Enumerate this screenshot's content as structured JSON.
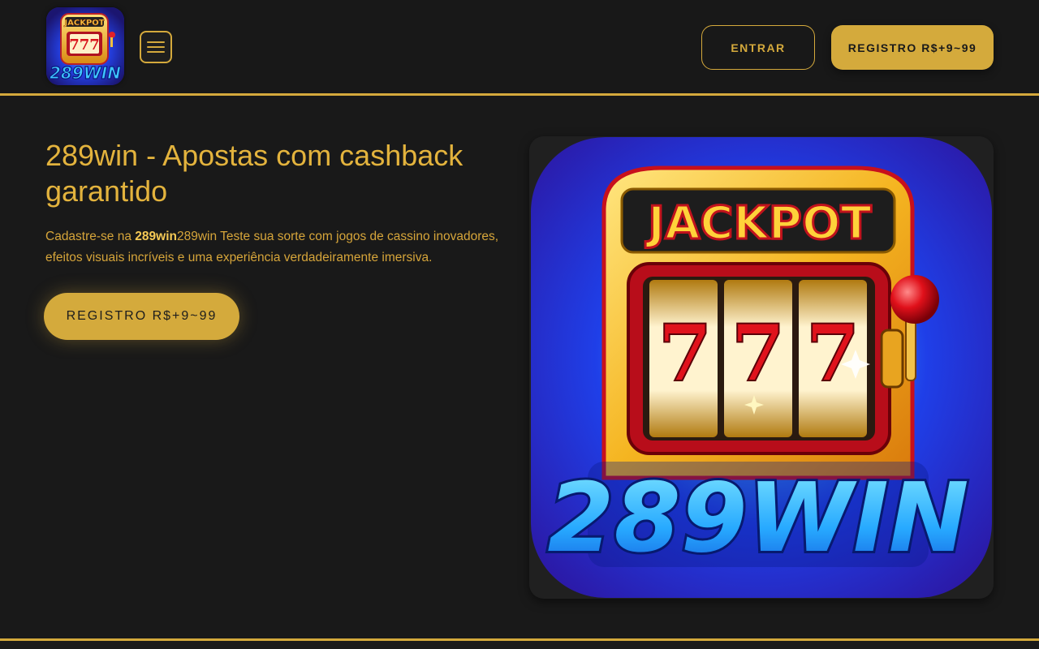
{
  "header": {
    "logo": {
      "top_text": "JACKPOT",
      "reel_text": "777",
      "brand_text": "289WIN"
    },
    "menu_icon": "hamburger-menu-icon",
    "login_label": "ENTRAR",
    "register_label": "REGISTRO R$+9~99"
  },
  "hero": {
    "title": "289win - Apostas com cashback garantido",
    "description": {
      "prefix": "Cadastre-se na ",
      "brand_bold": "289win",
      "suffix": "289win Teste sua sorte com jogos de cassino inovadores, efeitos visuais incríveis e uma experiência verdadeiramente imersiva."
    },
    "register_label": "REGISTRO R$+9~99",
    "image": {
      "top_text": "JACKPOT",
      "reel_symbol": "7",
      "brand_text": "289WIN"
    }
  },
  "colors": {
    "background": "#191919",
    "accent_gold": "#d4aa3c",
    "text_gold": "#e3b33d",
    "image_blue": "#1b3be0"
  }
}
